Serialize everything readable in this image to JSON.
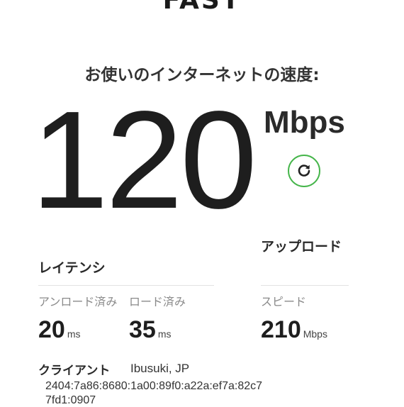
{
  "app": {
    "logo": "FAST"
  },
  "speed": {
    "heading": "お使いのインターネットの速度:",
    "value": "120",
    "unit": "Mbps",
    "refresh_icon": "refresh-icon"
  },
  "latency": {
    "title": "レイテンシ",
    "unloaded": {
      "label": "アンロード済み",
      "value": "20",
      "unit": "ms"
    },
    "loaded": {
      "label": "ロード済み",
      "value": "35",
      "unit": "ms"
    }
  },
  "upload": {
    "title": "アップロード",
    "speed_label": "スピード",
    "value": "210",
    "unit": "Mbps"
  },
  "client": {
    "label": "クライアント",
    "location": "Ibusuki, JP",
    "ip_line1": "2404:7a86:8680:1a00:89f0:a22a:ef7a:82c7",
    "ip_line2": "7fd1:0907"
  },
  "colors": {
    "accent": "#45b54a",
    "text": "#1e1e1e",
    "muted": "#8a8a8a"
  }
}
